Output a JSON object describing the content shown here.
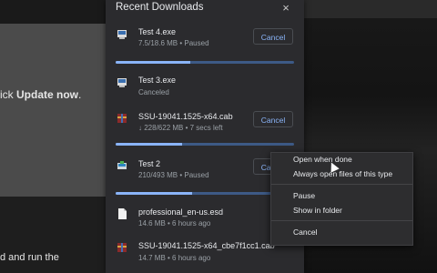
{
  "background": {
    "text_line1_prefix": "ick ",
    "text_line1_bold": "Update now",
    "text_line1_suffix": ".",
    "text_line2": "d and run the"
  },
  "panel": {
    "title": "Recent Downloads",
    "close_glyph": "×"
  },
  "downloads": [
    {
      "name": "Test 4.exe",
      "status": "7.5/18.6 MB • Paused",
      "button": "Cancel",
      "progress": 0.42,
      "icon": "exe-file-icon"
    },
    {
      "name": "Test 3.exe",
      "status": "Canceled",
      "icon": "exe-file-icon"
    },
    {
      "name": "SSU-19041.1525-x64.cab",
      "status": "↓ 228/622 MB • 7 secs left",
      "button": "Cancel",
      "progress": 0.37,
      "icon": "archive-file-icon"
    },
    {
      "name": "Test 2",
      "status": "210/493 MB • Paused",
      "button": "Cancel",
      "progress": 0.43,
      "icon": "installer-file-icon"
    },
    {
      "name": "professional_en-us.esd",
      "status": "14.6 MB • 6 hours ago",
      "icon": "blank-file-icon"
    },
    {
      "name": "SSU-19041.1525-x64_cbe7f1cc1.cab",
      "status": "14.7 MB • 6 hours ago",
      "icon": "archive-file-icon"
    }
  ],
  "context_menu": {
    "items": [
      "Open when done",
      "Always open files of this type",
      "Pause",
      "Show in folder",
      "Cancel"
    ]
  },
  "colors": {
    "accent": "#8ab4f8",
    "panel_bg": "#2b2b2e"
  }
}
